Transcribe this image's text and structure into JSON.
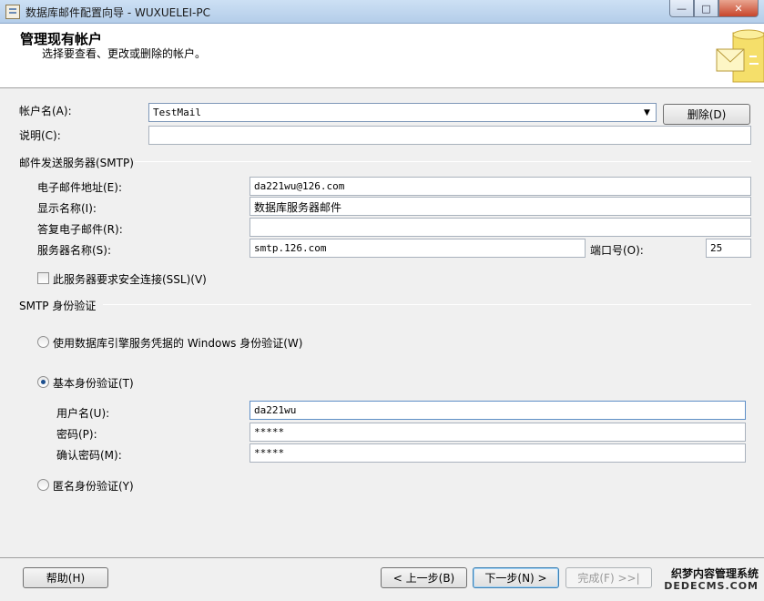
{
  "window": {
    "title": "数据库邮件配置向导 - WUXUELEI-PC",
    "minimize": "—",
    "maximize": "□",
    "close": "✕"
  },
  "header": {
    "title": "管理现有帐户",
    "subtitle": "选择要查看、更改或删除的帐户。"
  },
  "account": {
    "name_label": "帐户名(A):",
    "selected": "TestMail",
    "delete_button": "删除(D)",
    "description_label": "说明(C):",
    "description_value": ""
  },
  "smtp": {
    "group_label": "邮件发送服务器(SMTP)",
    "email_label": "电子邮件地址(E):",
    "email_value": "da221wu@126.com",
    "display_name_label": "显示名称(I):",
    "display_name_value": "数据库服务器邮件",
    "reply_label": "答复电子邮件(R):",
    "reply_value": "",
    "server_label": "服务器名称(S):",
    "server_value": "smtp.126.com",
    "port_label": "端口号(O):",
    "port_value": "25",
    "ssl_label": "此服务器要求安全连接(SSL)(V)",
    "ssl_checked": false
  },
  "auth": {
    "group_label": "SMTP 身份验证",
    "windows_label": "使用数据库引擎服务凭据的 Windows 身份验证(W)",
    "basic_label": "基本身份验证(T)",
    "username_label": "用户名(U):",
    "username_value": "da221wu",
    "password_label": "密码(P):",
    "password_value": "*****",
    "confirm_label": "确认密码(M):",
    "confirm_value": "*****",
    "anonymous_label": "匿名身份验证(Y)",
    "selected": "basic"
  },
  "footer": {
    "help": "帮助(H)",
    "back": "< 上一步(B)",
    "next": "下一步(N) >",
    "finish": "完成(F) >>|"
  },
  "watermark": {
    "line1": "织梦内容管理系统",
    "line2": "DEDECMS.COM"
  },
  "colors": {
    "window_bg": "#f0f0f0",
    "header_bg": "#ffffff",
    "titlebar": "#cde0f4",
    "close_button": "#c7452b",
    "radio_dot": "#1d4f8e"
  }
}
